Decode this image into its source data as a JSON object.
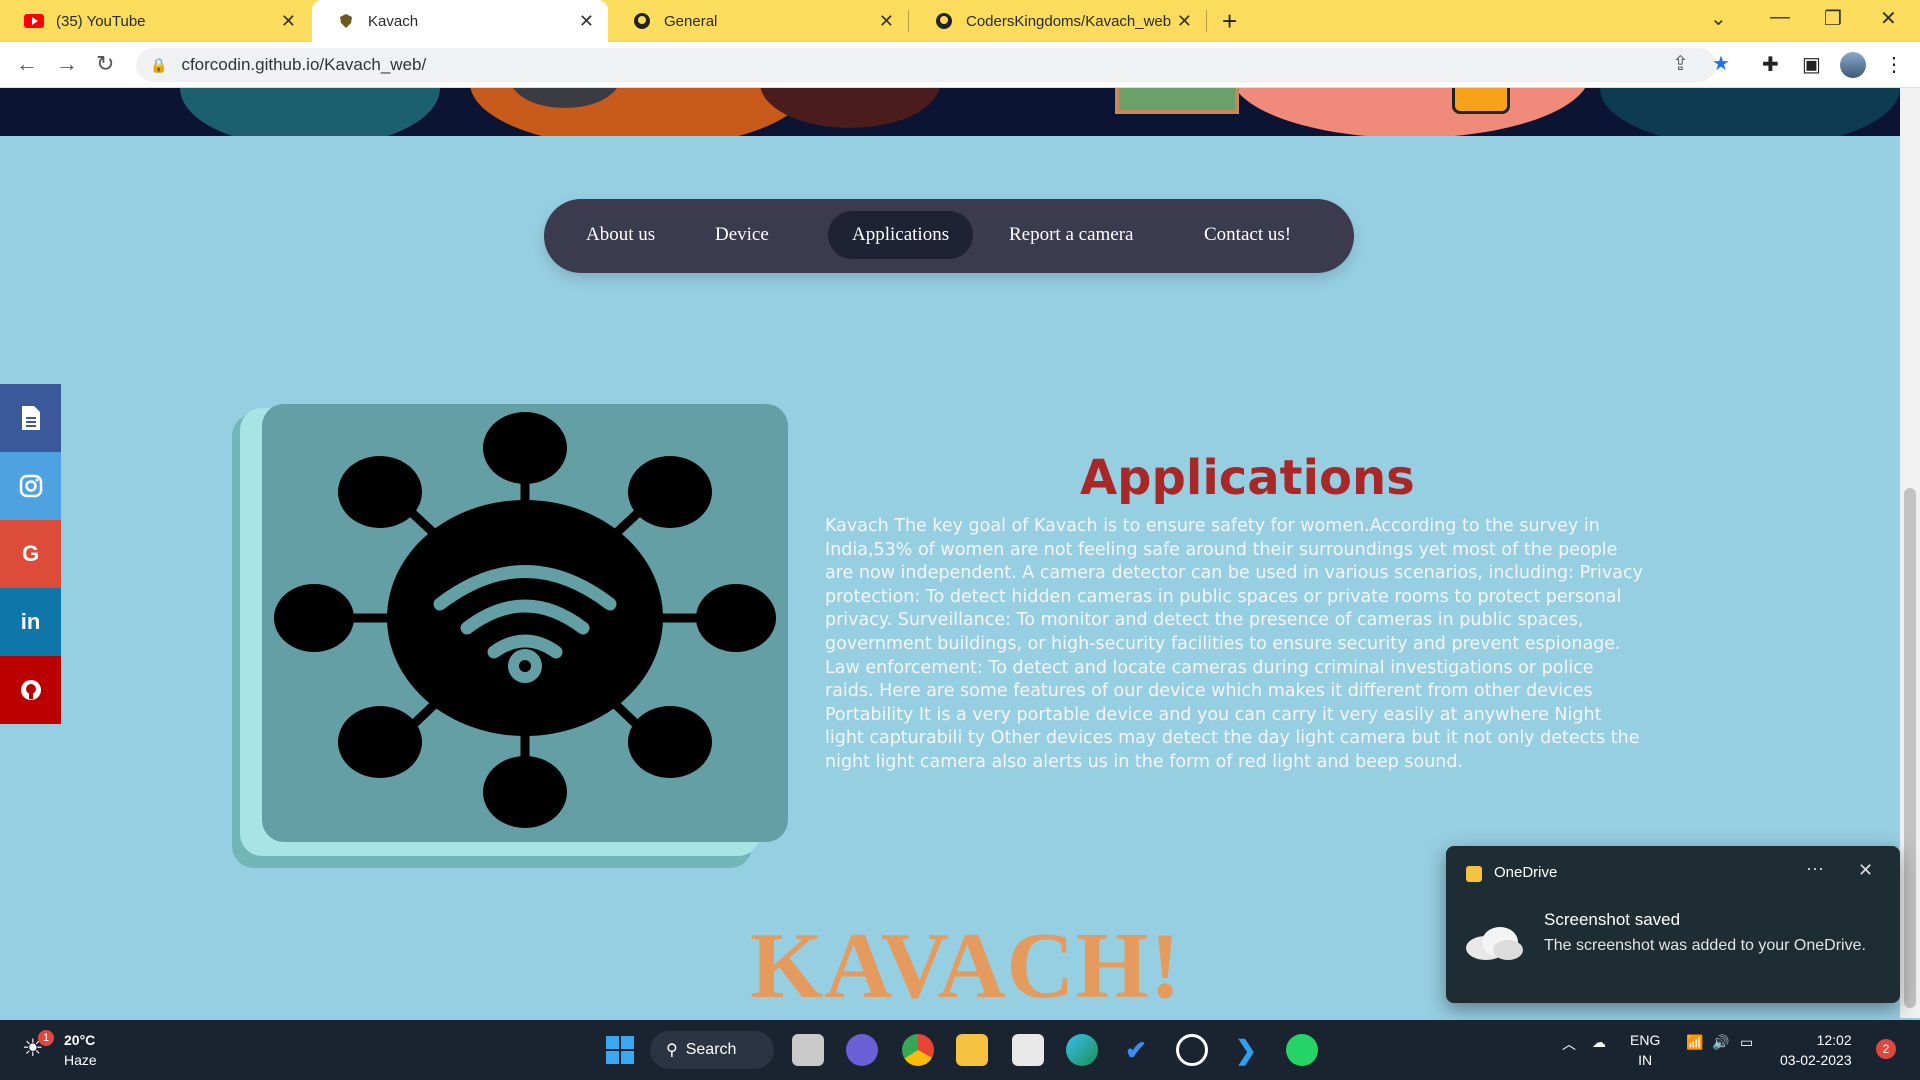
{
  "browser": {
    "tabs": [
      {
        "title": "(35) YouTube"
      },
      {
        "title": "Kavach"
      },
      {
        "title": "General"
      },
      {
        "title": "CodersKingdoms/Kavach_web"
      }
    ],
    "url": "cforcodin.github.io/Kavach_web/"
  },
  "nav": {
    "items": [
      "About us",
      "Device",
      "Applications",
      "Report a camera",
      "Contact us!"
    ],
    "active": "Applications"
  },
  "social": [
    {
      "icon": "document-icon",
      "color": "#3b5998"
    },
    {
      "icon": "instagram-icon",
      "color": "#4ea2e0"
    },
    {
      "icon": "google-icon",
      "color": "#dd4b39"
    },
    {
      "icon": "linkedin-icon",
      "color": "#0e76a8"
    },
    {
      "icon": "github-icon",
      "color": "#bb0000"
    }
  ],
  "section": {
    "title": "Applications",
    "body": "Kavach The key goal of Kavach is to ensure safety for women.According to the survey in India,53% of women are not feeling safe around their surroundings yet most of the people are now independent. A camera detector can be used in various scenarios, including: Privacy protection: To detect hidden cameras in public spaces or private rooms to protect personal privacy. Surveillance: To monitor and detect the presence of cameras in public spaces, government buildings, or high-security facilities to ensure security and prevent espionage. Law enforcement: To detect and locate cameras during criminal investigations or police raids. Here are some features of our device which makes it different from other devices Portability It is a very portable device and you can carry it very easily at anywhere Night light capturabili ty Other devices may detect the day light camera but it not only detects the night light camera also alerts us in the form of red light and beep sound.",
    "image_icon": "network-wifi-icon"
  },
  "brand": "KAVACH!",
  "toast": {
    "app": "OneDrive",
    "heading": "Screenshot saved",
    "message": "The screenshot was added to your OneDrive."
  },
  "taskbar": {
    "weather_temp": "20°C",
    "weather_desc": "Haze",
    "weather_badge": "1",
    "search_label": "Search",
    "lang": "ENG",
    "region": "IN",
    "time": "12:02",
    "date": "03-02-2023",
    "notifications": "2"
  },
  "colors": {
    "page_bg": "#97cfe2",
    "nav_bg": "#3b3a4f",
    "title": "#a82828",
    "brand": "#e59b5e"
  }
}
